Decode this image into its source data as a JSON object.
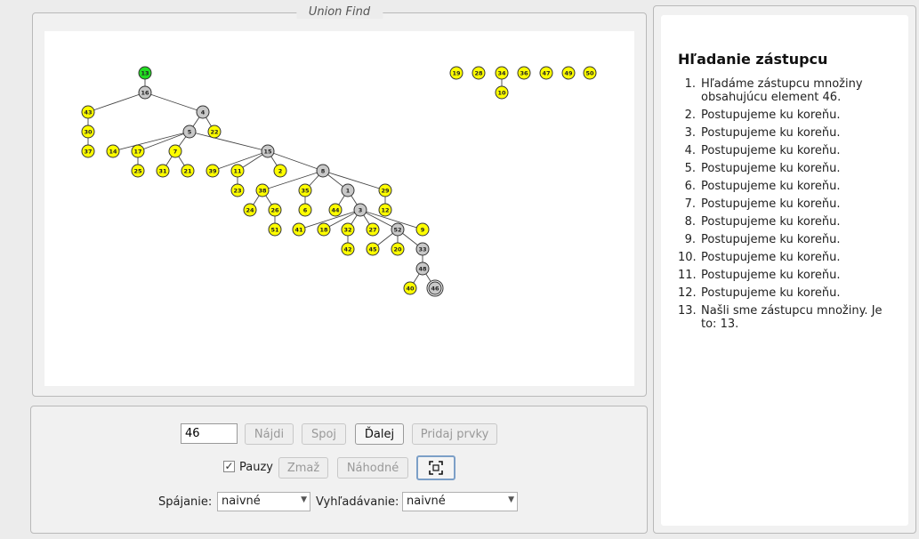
{
  "graph_panel": {
    "title": "Union Find"
  },
  "colors": {
    "root_found": "#22dd22",
    "visited": "#c8c8c8",
    "normal": "#ffff00",
    "edge": "#444444"
  },
  "graph": {
    "nodes": [
      {
        "id": "13",
        "state": "root"
      },
      {
        "id": "16",
        "state": "visited"
      },
      {
        "id": "43",
        "state": "normal"
      },
      {
        "id": "4",
        "state": "visited"
      },
      {
        "id": "30",
        "state": "normal"
      },
      {
        "id": "37",
        "state": "normal"
      },
      {
        "id": "5",
        "state": "visited"
      },
      {
        "id": "22",
        "state": "normal"
      },
      {
        "id": "14",
        "state": "normal"
      },
      {
        "id": "17",
        "state": "normal"
      },
      {
        "id": "7",
        "state": "normal"
      },
      {
        "id": "25",
        "state": "normal"
      },
      {
        "id": "31",
        "state": "normal"
      },
      {
        "id": "21",
        "state": "normal"
      },
      {
        "id": "15",
        "state": "visited"
      },
      {
        "id": "39",
        "state": "normal"
      },
      {
        "id": "11",
        "state": "normal"
      },
      {
        "id": "2",
        "state": "normal"
      },
      {
        "id": "23",
        "state": "normal"
      },
      {
        "id": "8",
        "state": "visited"
      },
      {
        "id": "38",
        "state": "normal"
      },
      {
        "id": "35",
        "state": "normal"
      },
      {
        "id": "1",
        "state": "visited"
      },
      {
        "id": "29",
        "state": "normal"
      },
      {
        "id": "24",
        "state": "normal"
      },
      {
        "id": "26",
        "state": "normal"
      },
      {
        "id": "6",
        "state": "normal"
      },
      {
        "id": "44",
        "state": "normal"
      },
      {
        "id": "3",
        "state": "visited"
      },
      {
        "id": "12",
        "state": "normal"
      },
      {
        "id": "51",
        "state": "normal"
      },
      {
        "id": "41",
        "state": "normal"
      },
      {
        "id": "18",
        "state": "normal"
      },
      {
        "id": "32",
        "state": "normal"
      },
      {
        "id": "27",
        "state": "normal"
      },
      {
        "id": "52",
        "state": "visited"
      },
      {
        "id": "9",
        "state": "normal"
      },
      {
        "id": "42",
        "state": "normal"
      },
      {
        "id": "45",
        "state": "normal"
      },
      {
        "id": "20",
        "state": "normal"
      },
      {
        "id": "33",
        "state": "visited"
      },
      {
        "id": "48",
        "state": "visited"
      },
      {
        "id": "40",
        "state": "normal"
      },
      {
        "id": "46",
        "state": "target"
      },
      {
        "id": "19",
        "state": "normal"
      },
      {
        "id": "28",
        "state": "normal"
      },
      {
        "id": "34",
        "state": "normal"
      },
      {
        "id": "36",
        "state": "normal"
      },
      {
        "id": "47",
        "state": "normal"
      },
      {
        "id": "49",
        "state": "normal"
      },
      {
        "id": "50",
        "state": "normal"
      },
      {
        "id": "10",
        "state": "normal"
      }
    ],
    "edges": [
      [
        "13",
        "16"
      ],
      [
        "16",
        "43"
      ],
      [
        "16",
        "4"
      ],
      [
        "43",
        "30"
      ],
      [
        "30",
        "37"
      ],
      [
        "4",
        "5"
      ],
      [
        "4",
        "22"
      ],
      [
        "5",
        "14"
      ],
      [
        "5",
        "17"
      ],
      [
        "5",
        "7"
      ],
      [
        "5",
        "15"
      ],
      [
        "17",
        "25"
      ],
      [
        "7",
        "31"
      ],
      [
        "7",
        "21"
      ],
      [
        "15",
        "39"
      ],
      [
        "15",
        "11"
      ],
      [
        "15",
        "2"
      ],
      [
        "15",
        "8"
      ],
      [
        "11",
        "23"
      ],
      [
        "8",
        "38"
      ],
      [
        "8",
        "35"
      ],
      [
        "8",
        "1"
      ],
      [
        "8",
        "29"
      ],
      [
        "38",
        "24"
      ],
      [
        "38",
        "26"
      ],
      [
        "26",
        "51"
      ],
      [
        "35",
        "6"
      ],
      [
        "1",
        "44"
      ],
      [
        "1",
        "3"
      ],
      [
        "29",
        "12"
      ],
      [
        "3",
        "41"
      ],
      [
        "3",
        "18"
      ],
      [
        "3",
        "32"
      ],
      [
        "3",
        "27"
      ],
      [
        "3",
        "52"
      ],
      [
        "3",
        "9"
      ],
      [
        "32",
        "42"
      ],
      [
        "52",
        "45"
      ],
      [
        "52",
        "20"
      ],
      [
        "52",
        "33"
      ],
      [
        "33",
        "48"
      ],
      [
        "48",
        "40"
      ],
      [
        "48",
        "46"
      ],
      [
        "34",
        "10"
      ]
    ]
  },
  "controls": {
    "element_value": "46",
    "find_label": "Nájdi",
    "union_label": "Spoj",
    "next_label": "Ďalej",
    "add_label": "Pridaj prvky",
    "pauses_label": "Pauzy",
    "pauses_checked": "✓",
    "delete_label": "Zmaž",
    "random_label": "Náhodné",
    "union_mode_label": "Spájanie:",
    "union_mode_value": "naivné",
    "find_mode_label": "Vyhľadávanie:",
    "find_mode_value": "naivné",
    "fit_icon": "fit-screen-icon"
  },
  "steps": {
    "title": "Hľadanie zástupcu",
    "items": [
      {
        "num": "1.",
        "text": "Hľadáme zástupcu množiny obsahujúcu element 46."
      },
      {
        "num": "2.",
        "text": "Postupujeme ku koreňu."
      },
      {
        "num": "3.",
        "text": "Postupujeme ku koreňu."
      },
      {
        "num": "4.",
        "text": "Postupujeme ku koreňu."
      },
      {
        "num": "5.",
        "text": "Postupujeme ku koreňu."
      },
      {
        "num": "6.",
        "text": "Postupujeme ku koreňu."
      },
      {
        "num": "7.",
        "text": "Postupujeme ku koreňu."
      },
      {
        "num": "8.",
        "text": "Postupujeme ku koreňu."
      },
      {
        "num": "9.",
        "text": "Postupujeme ku koreňu."
      },
      {
        "num": "10.",
        "text": "Postupujeme ku koreňu."
      },
      {
        "num": "11.",
        "text": "Postupujeme ku koreňu."
      },
      {
        "num": "12.",
        "text": "Postupujeme ku koreňu."
      },
      {
        "num": "13.",
        "text": "Našli sme zástupcu množiny. Je to: 13."
      }
    ]
  }
}
